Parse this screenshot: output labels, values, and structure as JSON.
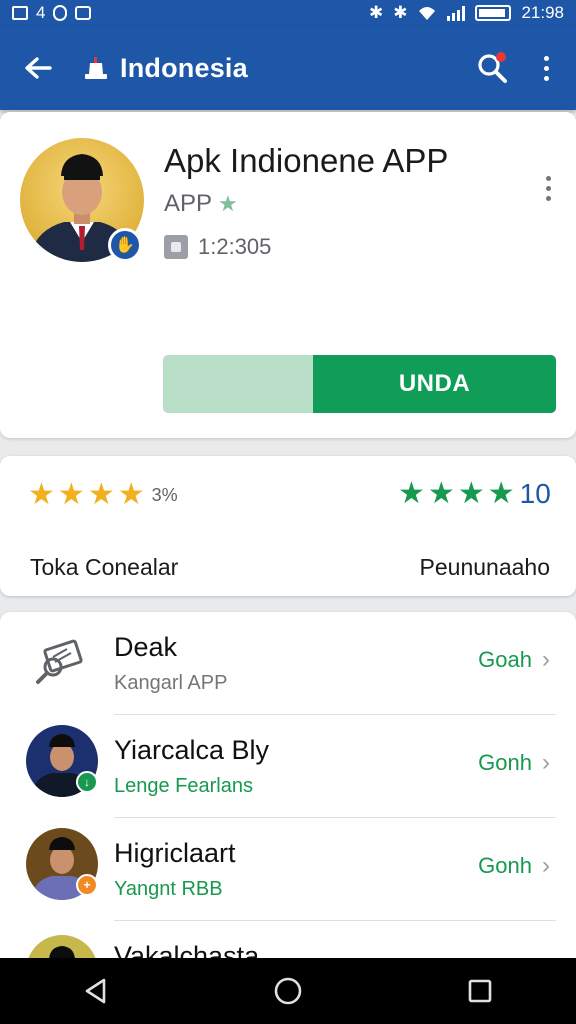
{
  "status_bar": {
    "left_number": "4",
    "time": "21:98"
  },
  "app_bar": {
    "title": "Indonesia",
    "back_icon": "arrow-left-icon",
    "search_icon": "search-icon",
    "menu_icon": "more-vert-icon"
  },
  "app_card": {
    "name": "Apk Indionene APP",
    "type_label": "APP",
    "meta_value": "1:2:305",
    "install_label": "UNDA",
    "colors": {
      "install": "#109d58",
      "secondary": "#b9dfc9"
    }
  },
  "rating_card": {
    "left_stars": 4,
    "left_percent": "3%",
    "right_stars": 4,
    "right_value": "10",
    "left_label": "Toka Conealar",
    "right_label": "Peununaaho"
  },
  "list": {
    "items": [
      {
        "title": "Deak",
        "subtitle": "Kangarl APP",
        "action": "Goah",
        "subtitle_color": "#757575"
      },
      {
        "title": "Yiarcalca Bly",
        "subtitle": "Lenge Fearlans",
        "action": "Gonh",
        "subtitle_color": "#17994f"
      },
      {
        "title": "Higriclaart",
        "subtitle": "Yangnt RBB",
        "action": "Gonh",
        "subtitle_color": "#17994f"
      },
      {
        "title": "Vakalchasta"
      }
    ]
  },
  "colors": {
    "primary": "#1e56a8",
    "accent_green": "#17994f",
    "star_yellow": "#f2b01e"
  }
}
